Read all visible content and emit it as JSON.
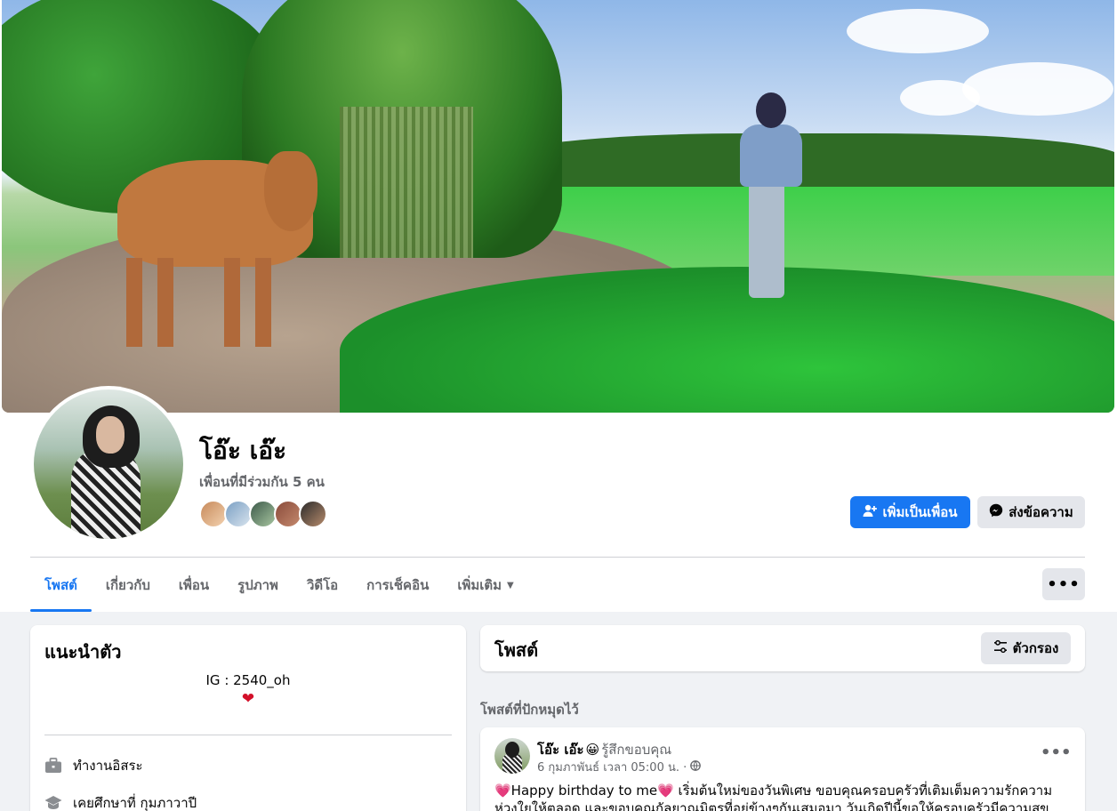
{
  "profile": {
    "name": "โอ๊ะ เอ๊ะ",
    "mutual_friends": "เพื่อนที่มีร่วมกัน 5 คน",
    "friend_avatar_colors": [
      "#c78a5b",
      "#7ba0c4",
      "#3d5a4a",
      "#8a4b3b",
      "#2b2b2b"
    ]
  },
  "actions": {
    "add_friend": "เพิ่มเป็นเพื่อน",
    "send_message": "ส่งข้อความ",
    "add_friend_icon": "add-friend-icon",
    "message_icon": "messenger-icon"
  },
  "tabs": {
    "posts": "โพสต์",
    "about": "เกี่ยวกับ",
    "friends": "เพื่อน",
    "photos": "รูปภาพ",
    "videos": "วิดีโอ",
    "checkins": "การเช็คอิน",
    "more": "เพิ่มเติม",
    "menu": "•••"
  },
  "intro": {
    "title": "แนะนำตัว",
    "bio": "IG : 2540_oh",
    "bio_emoji": "❤",
    "work": "ทำงานอิสระ",
    "education": "เคยศึกษาที่ กุมภาวาปี"
  },
  "posts_section": {
    "title": "โพสต์",
    "filter": "ตัวกรอง",
    "pinned_label": "โพสต์ที่ปักหมุดไว้"
  },
  "post": {
    "author": "โอ๊ะ เอ๊ะ",
    "feeling_emoji": "😀",
    "feeling": "รู้สึกขอบคุณ",
    "date": "6 กุมภาพันธ์ เวลา 05:00 น. ·",
    "menu": "•••",
    "text": "💗Happy birthday to me💗 เริ่มต้นใหม่ของวันพิเศษ ขอบคุณครอบครัวที่เติมเต็มความรักความห่วงใยให้ตลอด และขอบคุณกัลยาณมิตรที่อยู่ข้างๆกันเสมอมา วันเกิดปีนี้ขอให้ครอบครัวมีความสุข ปราศจากภัย"
  },
  "colors": {
    "accent": "#1877f2",
    "page_bg": "#f0f2f5",
    "secondary_text": "#65676b"
  }
}
